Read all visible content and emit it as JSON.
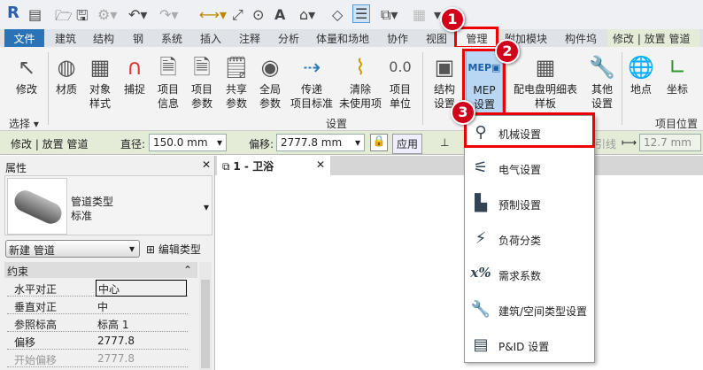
{
  "qat": {
    "logo": "R"
  },
  "tabs": {
    "file": "文件",
    "items": [
      "建筑",
      "结构",
      "钢",
      "系统",
      "插入",
      "注释",
      "分析",
      "体量和场地",
      "协作",
      "视图",
      "管理",
      "附加模块",
      "构件坞"
    ],
    "context": "修改 | 放置 管道"
  },
  "ribbon": {
    "buttons": [
      {
        "l1": "修改",
        "l2": ""
      },
      {
        "l1": "材质",
        "l2": ""
      },
      {
        "l1": "对象",
        "l2": "样式"
      },
      {
        "l1": "捕捉",
        "l2": ""
      },
      {
        "l1": "项目",
        "l2": "信息"
      },
      {
        "l1": "项目",
        "l2": "参数"
      },
      {
        "l1": "共享",
        "l2": "参数"
      },
      {
        "l1": "全局",
        "l2": "参数"
      },
      {
        "l1": "传递",
        "l2": "项目标准"
      },
      {
        "l1": "清除",
        "l2": "未使用项"
      },
      {
        "l1": "项目",
        "l2": "单位"
      },
      {
        "l1": "结构",
        "l2": "设置"
      },
      {
        "l1": "MEP",
        "l2": "设置"
      },
      {
        "l1": "配电盘明细表",
        "l2": "样板"
      },
      {
        "l1": "其他",
        "l2": "设置"
      },
      {
        "l1": "地点",
        "l2": ""
      },
      {
        "l1": "坐标",
        "l2": ""
      }
    ],
    "panels": {
      "select": "选择 ▾",
      "settings": "设置",
      "location": "项目位置"
    }
  },
  "options": {
    "context": "修改 | 放置 管道",
    "diameter_label": "直径:",
    "diameter": "150.0 mm",
    "offset_label": "偏移:",
    "offset": "2777.8 mm",
    "apply": "应用",
    "partial": "引线",
    "width": "12.7 mm"
  },
  "props": {
    "title": "属性",
    "type_family": "管道类型",
    "type_name": "标准",
    "instance": "新建 管道",
    "edit_type": "编辑类型",
    "section": "约束",
    "rows": [
      {
        "k": "水平对正",
        "v": "中心"
      },
      {
        "k": "垂直对正",
        "v": "中"
      },
      {
        "k": "参照标高",
        "v": "标高 1"
      },
      {
        "k": "偏移",
        "v": "2777.8"
      },
      {
        "k": "开始偏移",
        "v": "2777.8"
      }
    ]
  },
  "view_tab": {
    "label": "1 - 卫浴"
  },
  "menu": {
    "items": [
      "机械设置",
      "电气设置",
      "预制设置",
      "负荷分类",
      "需求系数",
      "建筑/空间类型设置",
      "P&ID 设置"
    ]
  },
  "badges": [
    "1",
    "2",
    "3"
  ],
  "colors": {
    "file_tab": "#2b73b7",
    "highlight": "#b9d7f2",
    "annotation": "#e00000",
    "options_bg": "#e4ecd8"
  }
}
